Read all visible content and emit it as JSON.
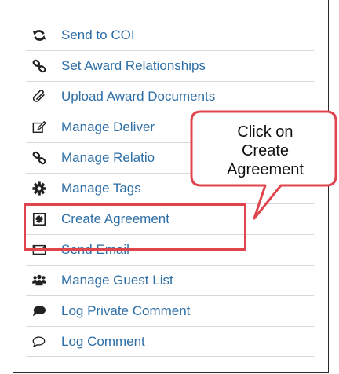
{
  "menu": {
    "items": [
      {
        "label": "Send to COI",
        "icon": "sync-icon"
      },
      {
        "label": "Set Award Relationships",
        "icon": "link-icon"
      },
      {
        "label": "Upload Award Documents",
        "icon": "paperclip-icon"
      },
      {
        "label": "Manage Deliver",
        "icon": "edit-icon"
      },
      {
        "label": "Manage Relatio",
        "icon": "link-icon"
      },
      {
        "label": "Manage Tags",
        "icon": "gear-icon"
      },
      {
        "label": "Create Agreement",
        "icon": "new-document-icon"
      },
      {
        "label": "Send Email",
        "icon": "envelope-icon"
      },
      {
        "label": "Manage Guest List",
        "icon": "group-icon"
      },
      {
        "label": "Log Private Comment",
        "icon": "comment-filled-icon"
      },
      {
        "label": "Log Comment",
        "icon": "comment-outline-icon"
      }
    ]
  },
  "callout": {
    "line1": "Click on",
    "line2": "Create",
    "line3": "Agreement"
  },
  "colors": {
    "link": "#2d6ea6",
    "icon": "#222222",
    "highlight": "#e0454d"
  }
}
